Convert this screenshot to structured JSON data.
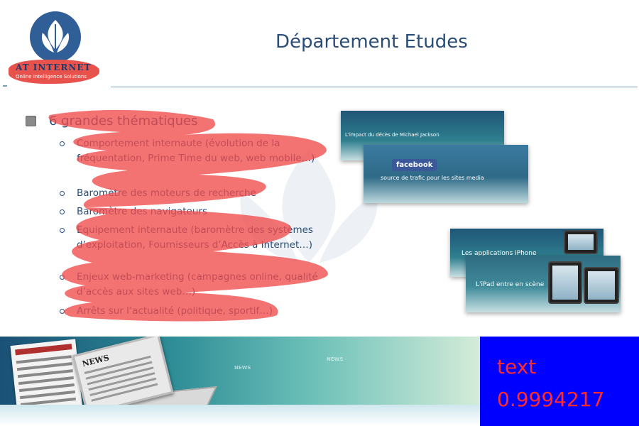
{
  "header": {
    "logo_brand": "AT INTERNET",
    "logo_tagline": "Online Intelligence Solutions",
    "title": "Département Etudes"
  },
  "content": {
    "main_bullet": "6 grandes thématiques",
    "items": [
      "Comportement internaute (évolution de la fréquentation, Prime Time du web, web mobile…)",
      "Baromètre des moteurs de recherche",
      "Baromètre des navigateurs",
      "Equipement internaute (baromètre des systèmes d’exploitation, Fournisseurs d’Accès à Internet…)",
      "Enjeux web-marketing (campagnes online, qualité d’accès aux sites web…)",
      "Arrêts sur l’actualité (politique, sportif…)"
    ]
  },
  "thumbnails": {
    "t1_caption": "L'impact du décès de Michael Jackson",
    "t2_badge": "facebook",
    "t2_caption": "source de trafic pour les sites media",
    "t3_caption": "Les applications iPhone",
    "t4_caption": "L'iPad entre en scène"
  },
  "banner": {
    "news_label": "NEWS"
  },
  "overlay": {
    "label": "text",
    "score": "0.9994217"
  },
  "colors": {
    "title": "#2a4d78",
    "scribble": "#f04b4b",
    "overlay_bg": "#0000ff",
    "overlay_text": "#ff2a2a"
  }
}
